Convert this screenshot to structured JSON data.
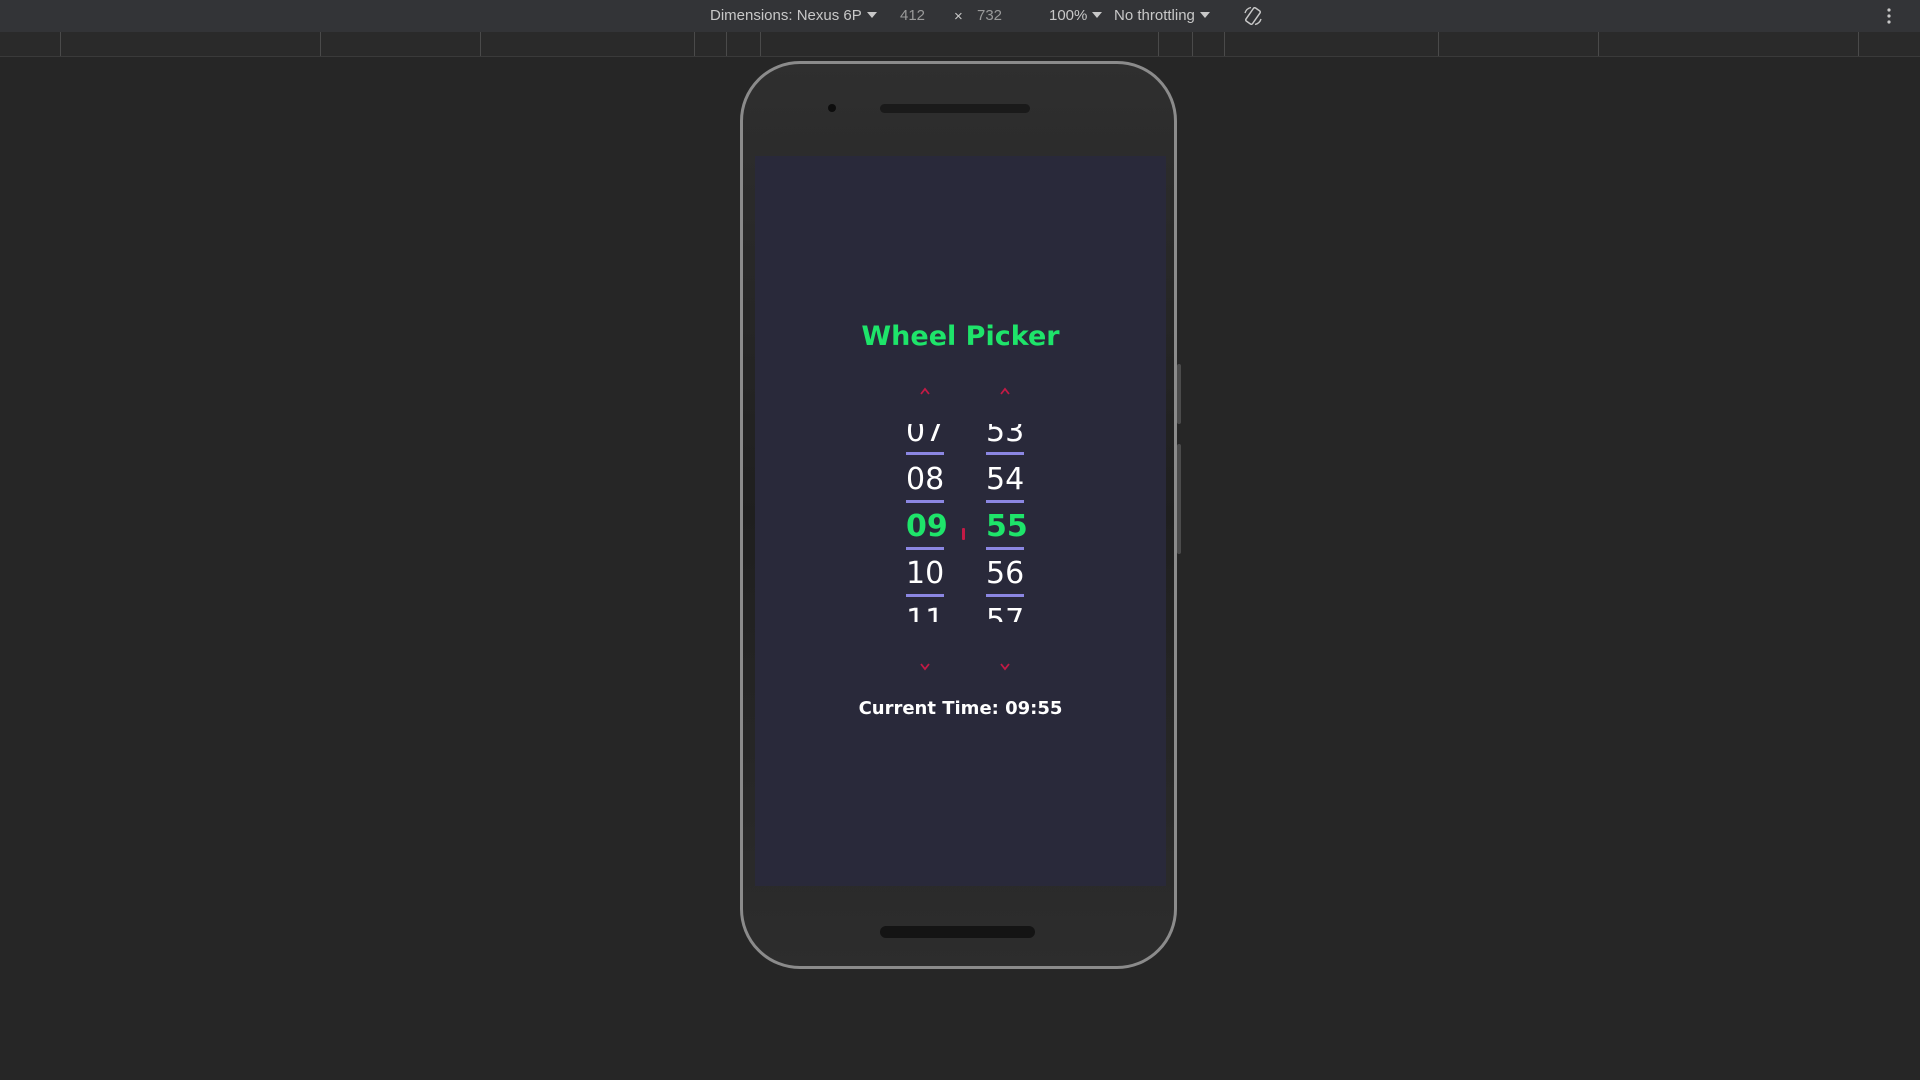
{
  "devtools": {
    "device_label": "Dimensions: Nexus 6P",
    "width": "412",
    "times": "×",
    "height": "732",
    "zoom": "100%",
    "throttling": "No throttling"
  },
  "app": {
    "title": "Wheel Picker",
    "hours": [
      "07",
      "08",
      "09",
      "10",
      "11"
    ],
    "minutes": [
      "53",
      "54",
      "55",
      "56",
      "57"
    ],
    "selected_hour": "09",
    "selected_minute": "55",
    "current_time_label": "Current Time: 09:55"
  },
  "colors": {
    "accent_green": "#1ee46a",
    "arrow_red": "#c21a45",
    "underline_purple": "#8b86e2",
    "screen_bg": "#29293a"
  },
  "icons": {
    "rotate": "rotate-device-icon",
    "more": "more-vertical-icon",
    "up": "chevron-up-icon",
    "down": "chevron-down-icon"
  }
}
